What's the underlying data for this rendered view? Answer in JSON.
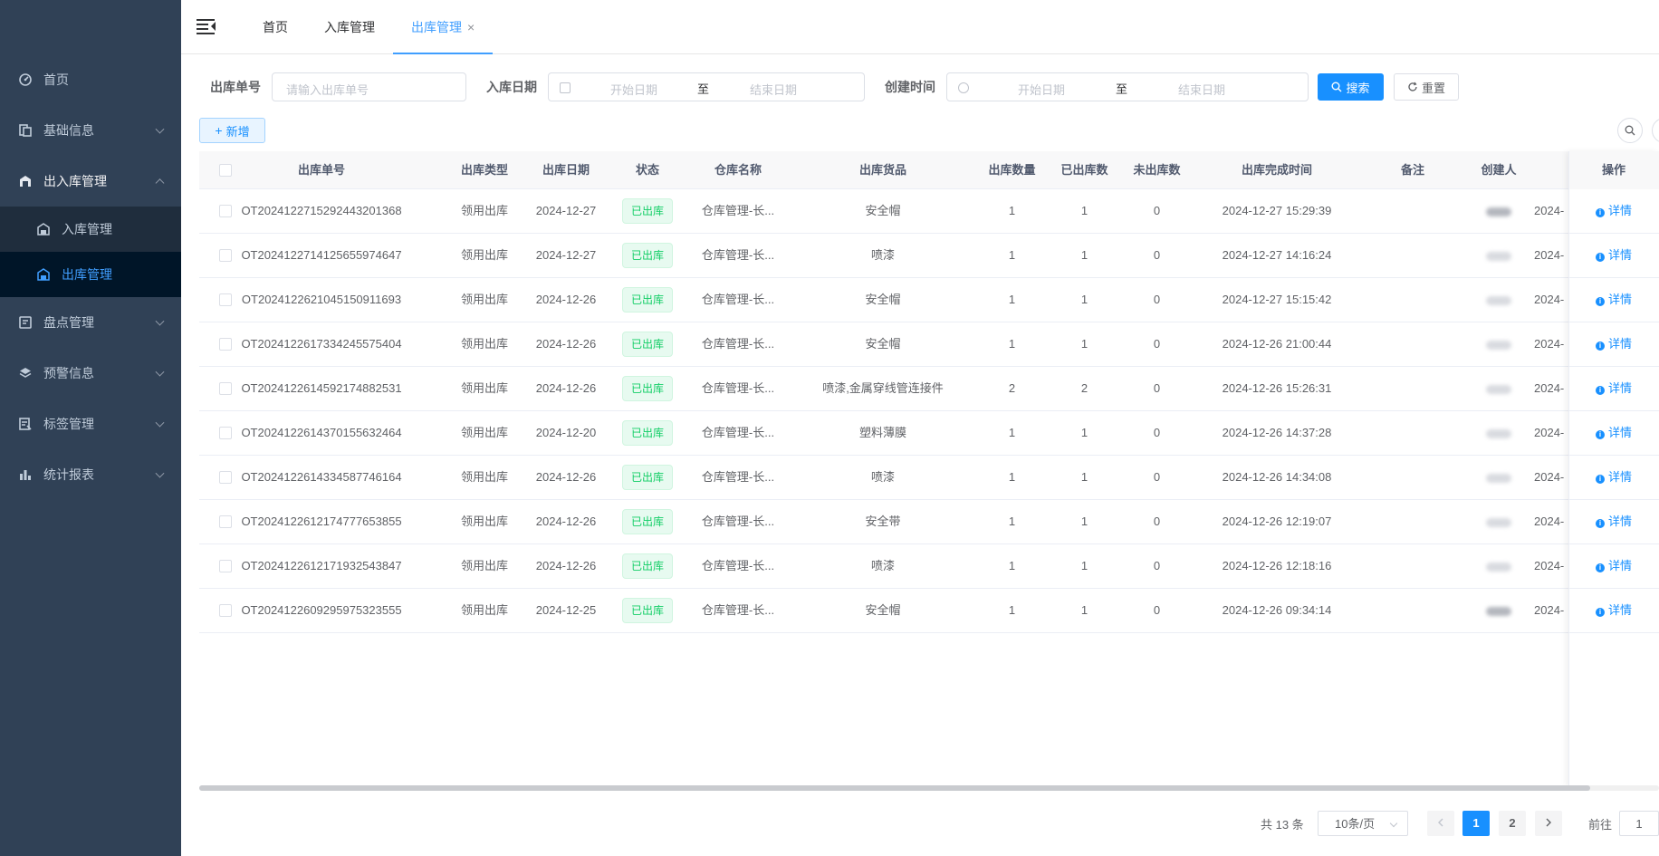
{
  "sidebar": {
    "items": [
      {
        "label": "首页",
        "icon": "dashboard-icon"
      },
      {
        "label": "基础信息",
        "icon": "documents-icon"
      },
      {
        "label": "出入库管理",
        "icon": "warehouse-icon"
      },
      {
        "label": "盘点管理",
        "icon": "inventory-icon"
      },
      {
        "label": "预警信息",
        "icon": "layers-icon"
      },
      {
        "label": "标签管理",
        "icon": "tag-doc-icon"
      },
      {
        "label": "统计报表",
        "icon": "bar-chart-icon"
      }
    ],
    "sub_items": [
      {
        "label": "入库管理",
        "icon": "inbound-icon"
      },
      {
        "label": "出库管理",
        "icon": "outbound-icon"
      }
    ]
  },
  "topbar": {
    "tabs": [
      {
        "label": "首页"
      },
      {
        "label": "入库管理"
      },
      {
        "label": "出库管理",
        "close": "×"
      }
    ]
  },
  "search": {
    "order_no_label": "出库单号",
    "order_no_placeholder": "请输入出库单号",
    "inbound_date_label": "入库日期",
    "created_time_label": "创建时间",
    "start_date": "开始日期",
    "end_date": "结束日期",
    "range_sep": "至",
    "search_btn": "搜索",
    "reset_btn": "重置"
  },
  "toolbar": {
    "add_btn": "新增"
  },
  "table": {
    "columns": [
      "出库单号",
      "出库类型",
      "出库日期",
      "状态",
      "仓库名称",
      "出库货品",
      "出库数量",
      "已出库数",
      "未出库数",
      "出库完成时间",
      "备注",
      "创建人",
      "操作"
    ],
    "action_label": "详情",
    "rows": [
      {
        "order_no": "OT20241227152924432013 68",
        "type": "领用出库",
        "date": "2024-12-27",
        "status": "已出库",
        "warehouse": "仓库管理-长...",
        "goods": "安全帽",
        "qty": "1",
        "done": "1",
        "left": "0",
        "finish": "2024-12-27 15:29:39",
        "note": "",
        "created": "2024-"
      },
      {
        "order_no": "OT20241227141256559746 47",
        "type": "领用出库",
        "date": "2024-12-27",
        "status": "已出库",
        "warehouse": "仓库管理-长...",
        "goods": "喷漆",
        "qty": "1",
        "done": "1",
        "left": "0",
        "finish": "2024-12-27 14:16:24",
        "note": "",
        "created": "2024-"
      },
      {
        "order_no": "OT20241226210451509116 93",
        "type": "领用出库",
        "date": "2024-12-26",
        "status": "已出库",
        "warehouse": "仓库管理-长...",
        "goods": "安全帽",
        "qty": "1",
        "done": "1",
        "left": "0",
        "finish": "2024-12-27 15:15:42",
        "note": "",
        "created": "2024-"
      },
      {
        "order_no": "OT20241226173342455754 04",
        "type": "领用出库",
        "date": "2024-12-26",
        "status": "已出库",
        "warehouse": "仓库管理-长...",
        "goods": "安全帽",
        "qty": "1",
        "done": "1",
        "left": "0",
        "finish": "2024-12-26 21:00:44",
        "note": "",
        "created": "2024-"
      },
      {
        "order_no": "OT20241226145921748825 31",
        "type": "领用出库",
        "date": "2024-12-26",
        "status": "已出库",
        "warehouse": "仓库管理-长...",
        "goods": "喷漆,金属穿线管连接件",
        "qty": "2",
        "done": "2",
        "left": "0",
        "finish": "2024-12-26 15:26:31",
        "note": "",
        "created": "2024-"
      },
      {
        "order_no": "OT20241226143701556324 64",
        "type": "领用出库",
        "date": "2024-12-20",
        "status": "已出库",
        "warehouse": "仓库管理-长...",
        "goods": "塑料薄膜",
        "qty": "1",
        "done": "1",
        "left": "0",
        "finish": "2024-12-26 14:37:28",
        "note": "",
        "created": "2024-"
      },
      {
        "order_no": "OT20241226143345877461 64",
        "type": "领用出库",
        "date": "2024-12-26",
        "status": "已出库",
        "warehouse": "仓库管理-长...",
        "goods": "喷漆",
        "qty": "1",
        "done": "1",
        "left": "0",
        "finish": "2024-12-26 14:34:08",
        "note": "",
        "created": "2024-"
      },
      {
        "order_no": "OT20241226121747776538 55",
        "type": "领用出库",
        "date": "2024-12-26",
        "status": "已出库",
        "warehouse": "仓库管理-长...",
        "goods": "安全带",
        "qty": "1",
        "done": "1",
        "left": "0",
        "finish": "2024-12-26 12:19:07",
        "note": "",
        "created": "2024-"
      },
      {
        "order_no": "OT20241226121719325438 47",
        "type": "领用出库",
        "date": "2024-12-26",
        "status": "已出库",
        "warehouse": "仓库管理-长...",
        "goods": "喷漆",
        "qty": "1",
        "done": "1",
        "left": "0",
        "finish": "2024-12-26 12:18:16",
        "note": "",
        "created": "2024-"
      },
      {
        "order_no": "OT20241226092959753235 55",
        "type": "领用出库",
        "date": "2024-12-25",
        "status": "已出库",
        "warehouse": "仓库管理-长...",
        "goods": "安全帽",
        "qty": "1",
        "done": "1",
        "left": "0",
        "finish": "2024-12-26 09:34:14",
        "note": "",
        "created": "2024-"
      }
    ]
  },
  "pagination": {
    "total": "共 13 条",
    "page_size": "10条/页",
    "pages": [
      "1",
      "2"
    ],
    "current": "1",
    "goto_label": "前往",
    "goto_value": "1"
  },
  "colors": {
    "sidebar_bg": "#304156",
    "primary": "#1890ff",
    "success": "#13ce66"
  }
}
